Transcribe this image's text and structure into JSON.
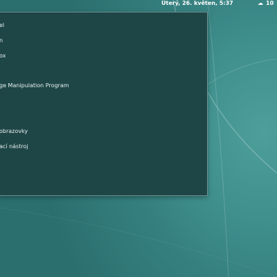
{
  "topbar": {
    "clock": "Úterý, 26. květen,  5:37",
    "weather_icon": "cloud-icon",
    "tray_text": "10"
  },
  "menu": {
    "items": [
      {
        "label": "el"
      },
      {
        "label": "n"
      },
      {
        "label": "ox"
      },
      {
        "label": "ge Manipulation Program"
      },
      {
        "label": "obrazovky"
      },
      {
        "label": "ací nástroj"
      }
    ]
  }
}
